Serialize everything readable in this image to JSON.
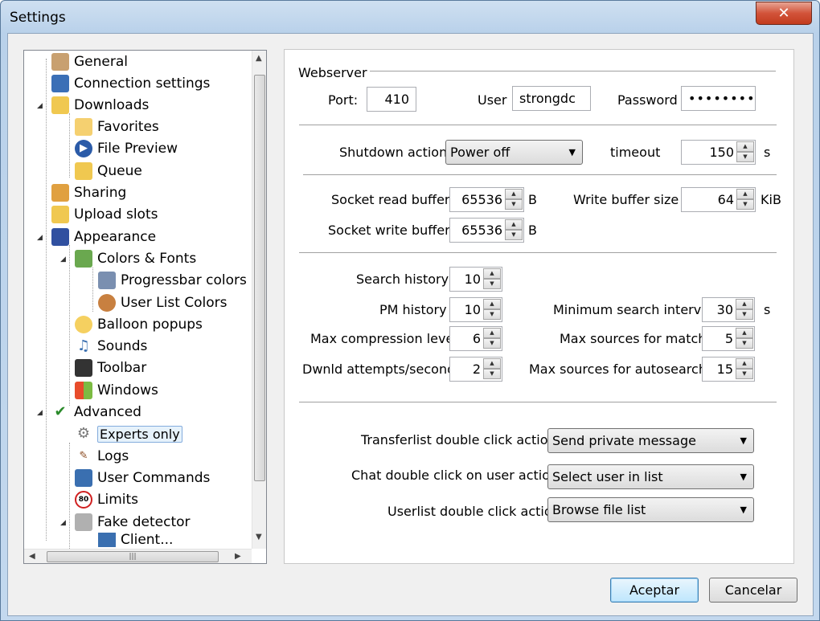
{
  "window": {
    "title": "Settings",
    "close_glyph": "✕"
  },
  "tree": {
    "items": [
      {
        "label": "General",
        "icon": "users-icon"
      },
      {
        "label": "Connection settings",
        "icon": "globe-icon"
      },
      {
        "label": "Downloads",
        "icon": "download-icon"
      },
      {
        "label": "Favorites",
        "icon": "star-folder-icon"
      },
      {
        "label": "File Preview",
        "icon": "play-icon"
      },
      {
        "label": "Queue",
        "icon": "queue-icon"
      },
      {
        "label": "Sharing",
        "icon": "share-icon"
      },
      {
        "label": "Upload slots",
        "icon": "upload-icon"
      },
      {
        "label": "Appearance",
        "icon": "monitor-icon"
      },
      {
        "label": "Colors & Fonts",
        "icon": "picture-icon"
      },
      {
        "label": "Progressbar colors",
        "icon": "progressbar-icon"
      },
      {
        "label": "User List Colors",
        "icon": "user-icon"
      },
      {
        "label": "Balloon popups",
        "icon": "balloon-icon"
      },
      {
        "label": "Sounds",
        "icon": "music-note-icon"
      },
      {
        "label": "Toolbar",
        "icon": "toolbar-icon"
      },
      {
        "label": "Windows",
        "icon": "windows-logo-icon"
      },
      {
        "label": "Advanced",
        "icon": "checkmark-icon"
      },
      {
        "label": "Experts only",
        "icon": "gear-icon"
      },
      {
        "label": "Logs",
        "icon": "pen-icon"
      },
      {
        "label": "User Commands",
        "icon": "command-icon"
      },
      {
        "label": "Limits",
        "icon": "speed-limit-icon",
        "badge": "80"
      },
      {
        "label": "Fake detector",
        "icon": "lock-icon"
      },
      {
        "label": "Client...",
        "icon": "client-icon"
      }
    ],
    "selected": "Experts only"
  },
  "webserver": {
    "heading": "Webserver",
    "port_label": "Port:",
    "port_value": "410",
    "user_label": "User",
    "user_value": "strongdc",
    "password_label": "Password",
    "password_value": "••••••••"
  },
  "shutdown": {
    "action_label": "Shutdown action",
    "action_value": "Power off",
    "timeout_label": "timeout",
    "timeout_value": "150",
    "timeout_unit": "s"
  },
  "buffers": {
    "read_label": "Socket read buffer",
    "read_value": "65536",
    "read_unit": "B",
    "write_size_label": "Write buffer size",
    "write_size_value": "64",
    "write_size_unit": "KiB",
    "write_label": "Socket write buffer",
    "write_value": "65536",
    "write_unit": "B"
  },
  "misc": {
    "search_history_label": "Search history",
    "search_history_value": "10",
    "pm_history_label": "PM history",
    "pm_history_value": "10",
    "min_search_label": "Minimum search interval",
    "min_search_value": "30",
    "min_search_unit": "s",
    "max_comp_label": "Max compression level",
    "max_comp_value": "6",
    "max_sources_label": "Max sources for match",
    "max_sources_value": "5",
    "dl_attempts_label": "Dwnld attempts/second",
    "dl_attempts_value": "2",
    "max_auto_label": "Max sources for autosearch",
    "max_auto_value": "15"
  },
  "actions": {
    "transfer_label": "Transferlist double click action",
    "transfer_value": "Send private message",
    "chat_label": "Chat double click on user action",
    "chat_value": "Select user in list",
    "userlist_label": "Userlist double click action",
    "userlist_value": "Browse file list"
  },
  "buttons": {
    "ok": "Aceptar",
    "cancel": "Cancelar"
  }
}
